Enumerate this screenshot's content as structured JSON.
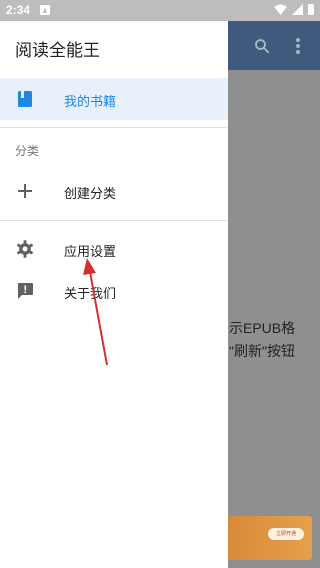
{
  "status_bar": {
    "time": "2:34"
  },
  "drawer": {
    "app_title": "阅读全能王",
    "my_books": {
      "label": "我的书籍",
      "icon": "book-icon"
    },
    "category_section": {
      "label": "分类"
    },
    "create_category": {
      "label": "创建分类",
      "icon": "plus-icon"
    },
    "app_settings": {
      "label": "应用设置",
      "icon": "gear-icon"
    },
    "about_us": {
      "label": "关于我们",
      "icon": "feedback-icon"
    }
  },
  "background": {
    "text_line_1": "示EPUB格",
    "text_line_2": "\"刷新\"按钮",
    "ad_button": "立即开通"
  },
  "colors": {
    "accent": "#1e88e5",
    "active_bg": "#e8f1fb",
    "toolbar": "#3f5a7c",
    "annotation": "#d32f2f"
  }
}
